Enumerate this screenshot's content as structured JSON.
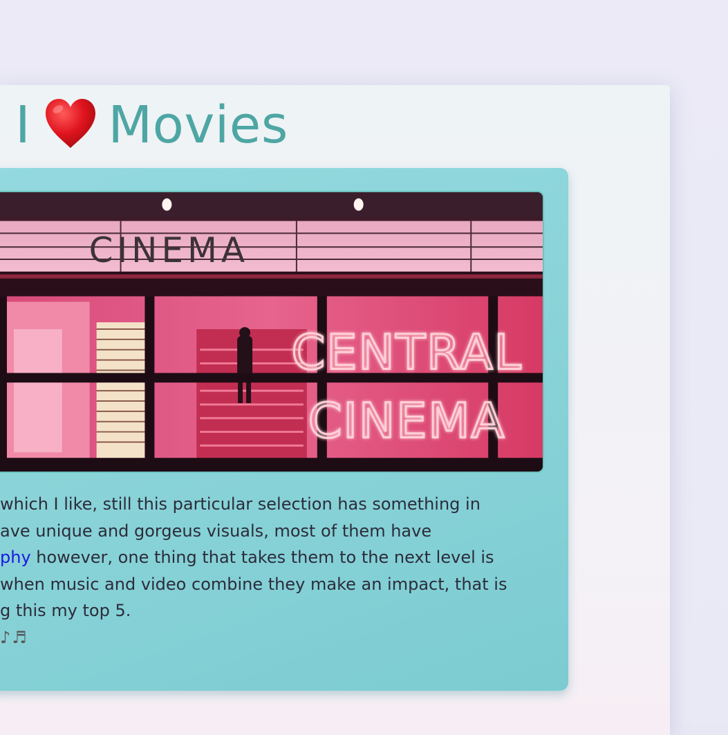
{
  "header": {
    "title_prefix": "I",
    "heart_icon": "red-heart",
    "title_suffix": "Movies",
    "title_color": "#4ea6a4"
  },
  "hero_image": {
    "sign_top": "CINEMA",
    "neon_line1": "CENTRAL",
    "neon_line2": "CINEMA"
  },
  "paragraph": {
    "line1": "which I like, still this particular selection has something in",
    "line2": "ave unique and gorgeus visuals, most of them have",
    "line3_link": "phy",
    "line3_rest": " however, one thing that takes them to the next level is",
    "line4": "when music and video combine they make an impact, that is",
    "line5": "g this my top 5.",
    "line6": "♪♬"
  },
  "colors": {
    "card_bg": "#89d3d8",
    "link": "#1a1ae0",
    "text": "#2c2c3a"
  }
}
